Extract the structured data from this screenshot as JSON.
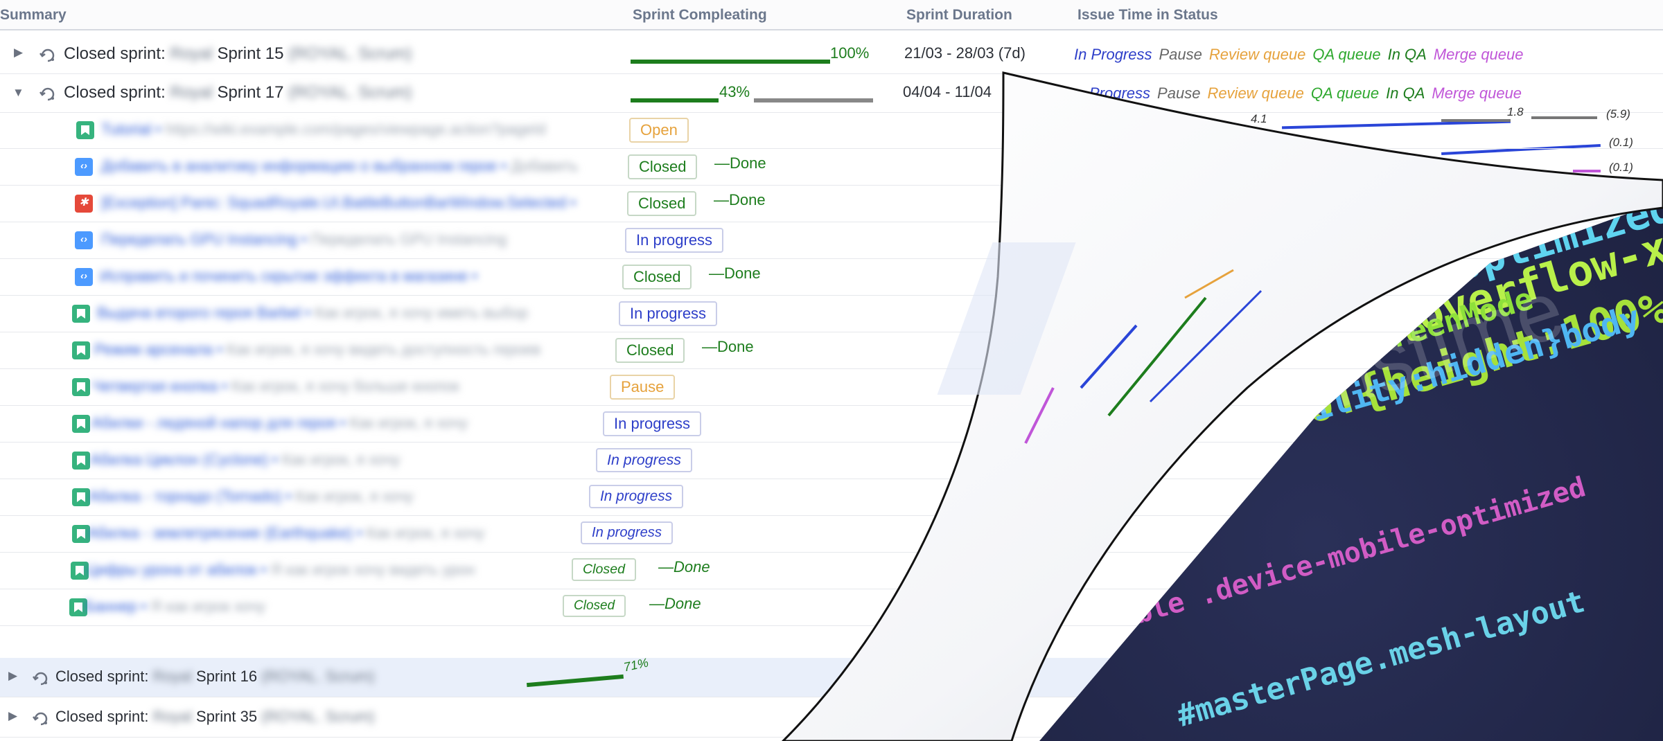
{
  "columns": {
    "summary": "Summary",
    "sprint_completing": "Sprint Compleating",
    "sprint_duration": "Sprint Duration",
    "issue_time_in_status": "Issue Time in Status"
  },
  "sprints": [
    {
      "label": "Closed sprint:",
      "name": "Sprint 15",
      "percent": "100%",
      "percent_value": 100,
      "duration": "21/03 - 28/03 (7d)",
      "blurred_prefix": "Royal",
      "blurred_suffix": "(ROYAL. Scrum)"
    },
    {
      "label": "Closed sprint:",
      "name": "Sprint 17",
      "percent": "43%",
      "percent_value": 43,
      "duration": "04/04 - 11/04",
      "blurred_prefix": "Royal",
      "blurred_suffix": "(ROYAL. Scrum)"
    },
    {
      "label": "Closed sprint:",
      "name": "Sprint 16",
      "percent": "71%",
      "percent_value": 71,
      "blurred_prefix": "Royal",
      "blurred_suffix": "(ROYAL. Scrum)"
    },
    {
      "label": "Closed sprint:",
      "name": "Sprint 35",
      "blurred_prefix": "Royal",
      "blurred_suffix": "(ROYAL. Scrum)"
    }
  ],
  "statuses": {
    "in_progress": "In Progress",
    "pause": "Pause",
    "review_queue": "Review queue",
    "qa_queue": "QA queue",
    "in_qa": "In QA",
    "merge_queue": "Merge queue",
    "in_progress_partial": "Progress"
  },
  "status_colors": {
    "in_progress": "#2e3fc9",
    "pause": "#666666",
    "review_queue": "#e6a23c",
    "qa_queue": "#2ea82e",
    "in_qa": "#1d7d1d",
    "merge_queue": "#c056d8"
  },
  "mini_chart": {
    "val1": "4.1",
    "val2": "1.8",
    "total1": "(5.9)",
    "total2": "(0.1)",
    "total3": "(0.1)"
  },
  "issues": [
    {
      "type": "story",
      "title": "Tutorial",
      "sub": "https://wiki.example.com/pages/viewpage.action?pageId",
      "status": "Open",
      "done": ""
    },
    {
      "type": "task",
      "title": "Добавить в аналитику информацию о выбранном герое",
      "sub": "Добавить",
      "status": "Closed",
      "done": "—Done"
    },
    {
      "type": "bug",
      "title": "[Exception] Panic: SquadRoyale.UI.BattleButtonBarWindow.Selected",
      "sub": "",
      "status": "Closed",
      "done": "—Done"
    },
    {
      "type": "task",
      "title": "Переделать GPU Instancing",
      "sub": "Переделать GPU Instancing",
      "status": "In progress",
      "done": ""
    },
    {
      "type": "task",
      "title": "Исправить и починить скрытие эффекта в магазине",
      "sub": "",
      "status": "Closed",
      "done": "—Done"
    },
    {
      "type": "story",
      "title": "Выдача второго героя Barbel",
      "sub": "Как игрок, я хочу иметь выбор",
      "status": "In progress",
      "done": ""
    },
    {
      "type": "story",
      "title": "Режим арсенала",
      "sub": "Как игрок, я хочу видеть доступность героев",
      "status": "Closed",
      "done": "—Done"
    },
    {
      "type": "story",
      "title": "Четвертая кнопка",
      "sub": "Как игрок, я хочу больше кнопок",
      "status": "Pause",
      "done": ""
    },
    {
      "type": "story",
      "title": "Абилки - ледяной напор для героя",
      "sub": "Как игрок, я хочу",
      "status": "In progress",
      "done": ""
    },
    {
      "type": "story",
      "title": "Абилка Циклон (Cyclone)",
      "sub": "Как игрок, я хочу",
      "status": "In progress",
      "done": ""
    },
    {
      "type": "story",
      "title": "Абилка - торнадо (Tornado)",
      "sub": "Как игрок, я хочу",
      "status": "In progress",
      "done": ""
    },
    {
      "type": "story",
      "title": "Абилка - землетрясение (Earthquake)",
      "sub": "Как игрок, я хочу",
      "status": "In progress",
      "done": ""
    },
    {
      "type": "story",
      "title": "Цифры урона от абилок",
      "sub": "Я как игрок хочу видеть урон",
      "status": "Closed",
      "done": "—Done"
    },
    {
      "type": "story",
      "title": "Баннер",
      "sub": "Я как игрок хочу",
      "status": "Closed",
      "done": "—Done"
    }
  ],
  "code_lines": [
    ".fullScreenMode.device-mobile-optimized",
    "-scrollable.device-mobile-optimized",
    "Mode-scrollable.device-mobile-optimized",
    "eenMode-scrollable .SITE_ROOT{overflow-x:hidden}",
    "mobile-optimized .SITE_ROOT{height:100%}",
    "roll able .device-mobile-optimized",
    "E_ROOT{visibility:hidden}body",
    "optimized.fullScreenMode",
    "#masterPage.mesh-layout"
  ],
  "watermark": "dreamstime",
  "colors": {
    "done_green": "#1d7d1d",
    "bar_green": "#1d7d1d",
    "bar_grey": "#888888",
    "open_orange": "#e6a23c",
    "in_progress_blue": "#2e3fc9",
    "code_bg": "#161a34"
  }
}
